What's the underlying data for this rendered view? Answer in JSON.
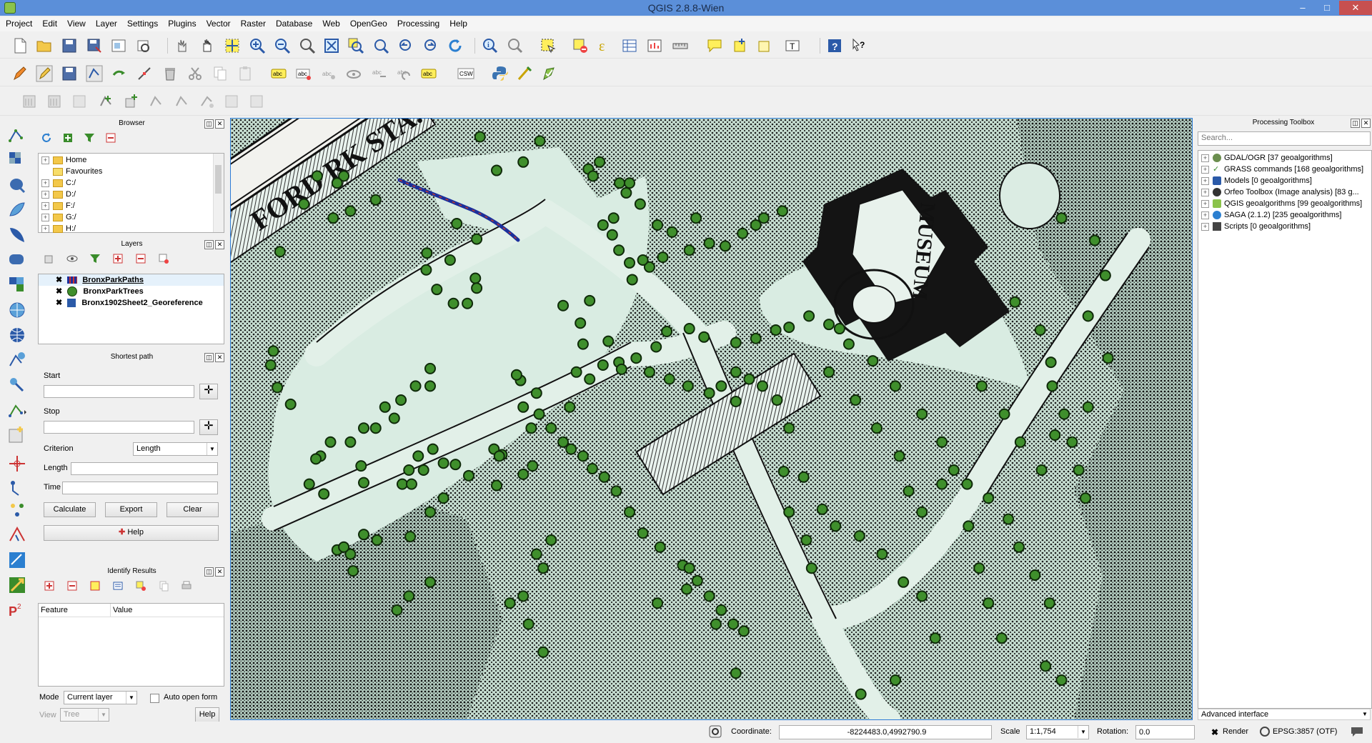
{
  "window": {
    "title": "QGIS 2.8.8-Wien",
    "minimize": "–",
    "maximize": "□",
    "close": "✕"
  },
  "menu": [
    "Project",
    "Edit",
    "View",
    "Layer",
    "Settings",
    "Plugins",
    "Vector",
    "Raster",
    "Database",
    "Web",
    "OpenGeo",
    "Processing",
    "Help"
  ],
  "browser": {
    "title": "Browser",
    "items": [
      "Home",
      "Favourites",
      "C:/",
      "D:/",
      "F:/",
      "G:/",
      "H:/"
    ]
  },
  "layers": {
    "title": "Layers",
    "items": [
      "BronxParkPaths",
      "BronxParkTrees",
      "Bronx1902Sheet2_Georeference"
    ]
  },
  "shortest_path": {
    "title": "Shortest path",
    "start_label": "Start",
    "stop_label": "Stop",
    "criterion_label": "Criterion",
    "criterion_value": "Length",
    "length_label": "Length",
    "time_label": "Time",
    "calculate": "Calculate",
    "export": "Export",
    "clear": "Clear",
    "help": "Help"
  },
  "identify": {
    "title": "Identify Results",
    "col_feature": "Feature",
    "col_value": "Value",
    "mode_label": "Mode",
    "mode_value": "Current layer",
    "auto_open": "Auto open form",
    "view_label": "View",
    "view_value": "Tree",
    "help": "Help"
  },
  "map_text": {
    "museum": "MUSEUM",
    "station": "FORD\nRK STA."
  },
  "processing": {
    "title": "Processing Toolbox",
    "search_placeholder": "Search...",
    "items": [
      "GDAL/OGR [37 geoalgorithms]",
      "GRASS commands [168 geoalgorithms]",
      "Models [0 geoalgorithms]",
      "Orfeo Toolbox (Image analysis) [83 g...",
      "QGIS geoalgorithms [99 geoalgorithms]",
      "SAGA (2.1.2) [235 geoalgorithms]",
      "Scripts [0 geoalgorithms]"
    ],
    "advanced": "Advanced interface"
  },
  "status": {
    "coordinate_label": "Coordinate:",
    "coordinate": "-8224483.0,4992790.9",
    "scale_label": "Scale",
    "scale": "1:1,754",
    "rotation_label": "Rotation:",
    "rotation": "0.0",
    "render": "Render",
    "crs": "EPSG:3857 (OTF)"
  },
  "colors": {
    "titlebar": "#5b8fd9",
    "map_bg": "#d6eae0",
    "tree_fill": "#3f8f2c",
    "path_line": "#1b2f9c",
    "map_border": "#2c7bd6"
  }
}
